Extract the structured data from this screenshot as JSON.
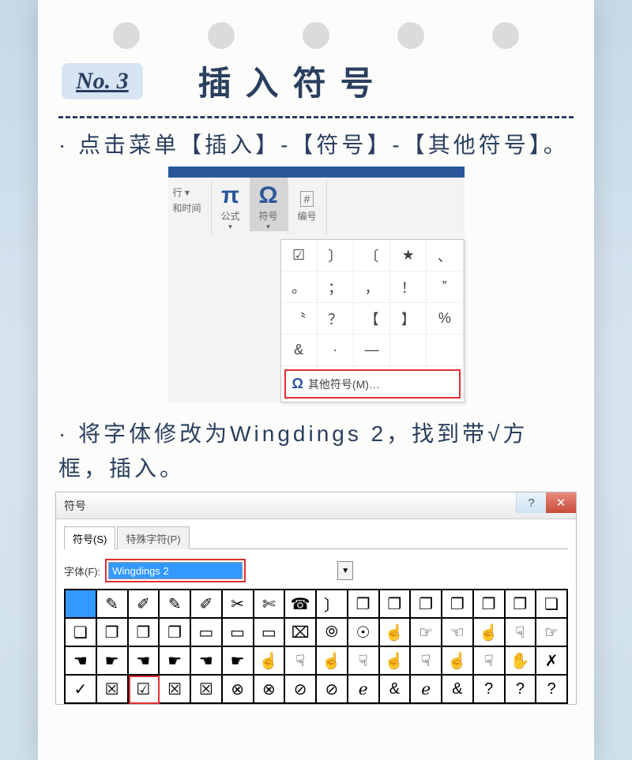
{
  "header": {
    "badge": "No. 3",
    "title": "插入符号"
  },
  "instr1": "· 点击菜单【插入】-【符号】-【其他符号】。",
  "instr2": "· 将字体修改为Wingdings 2，找到带√方框，插入。",
  "ribbon": {
    "left1": "行 ▾",
    "left2": "和时间",
    "eq": "公式",
    "sym": "符号",
    "num": "编号"
  },
  "symgrid": [
    "☑",
    "〕",
    "〔",
    "★",
    "、",
    "。",
    "；",
    "，",
    "！",
    "‟",
    "〝",
    "？",
    "【",
    "】",
    "%",
    "&",
    "·",
    "—",
    "",
    ""
  ],
  "other": "其他符号(M)…",
  "dialog": {
    "title": "符号",
    "tab1": "符号(S)",
    "tab2": "特殊字符(P)",
    "fontlabel": "字体(F):",
    "fontvalue": "Wingdings 2"
  },
  "grid": [
    "",
    "✎",
    "✐",
    "✎",
    "✐",
    "✂",
    "✄",
    "☎",
    "〕",
    "❐",
    "❐",
    "❐",
    "❐",
    "❐",
    "❐",
    "❏",
    "❏",
    "❐",
    "❐",
    "❐",
    "▭",
    "▭",
    "▭",
    "⌧",
    "⦾",
    "☉",
    "☝",
    "☞",
    "☜",
    "☝",
    "☟",
    "☞",
    "☚",
    "☛",
    "☚",
    "☛",
    "☚",
    "☛",
    "☝",
    "☟",
    "☝",
    "☟",
    "☝",
    "☟",
    "☝",
    "☟",
    "✋",
    "✗",
    "✓",
    "☒",
    "☑",
    "☒",
    "☒",
    "⊗",
    "⊗",
    "⊘",
    "⊘",
    "ℯ",
    "&",
    "ℯ",
    "&",
    "?",
    "?",
    "?"
  ],
  "grid_sel": 0,
  "grid_hl": 50
}
